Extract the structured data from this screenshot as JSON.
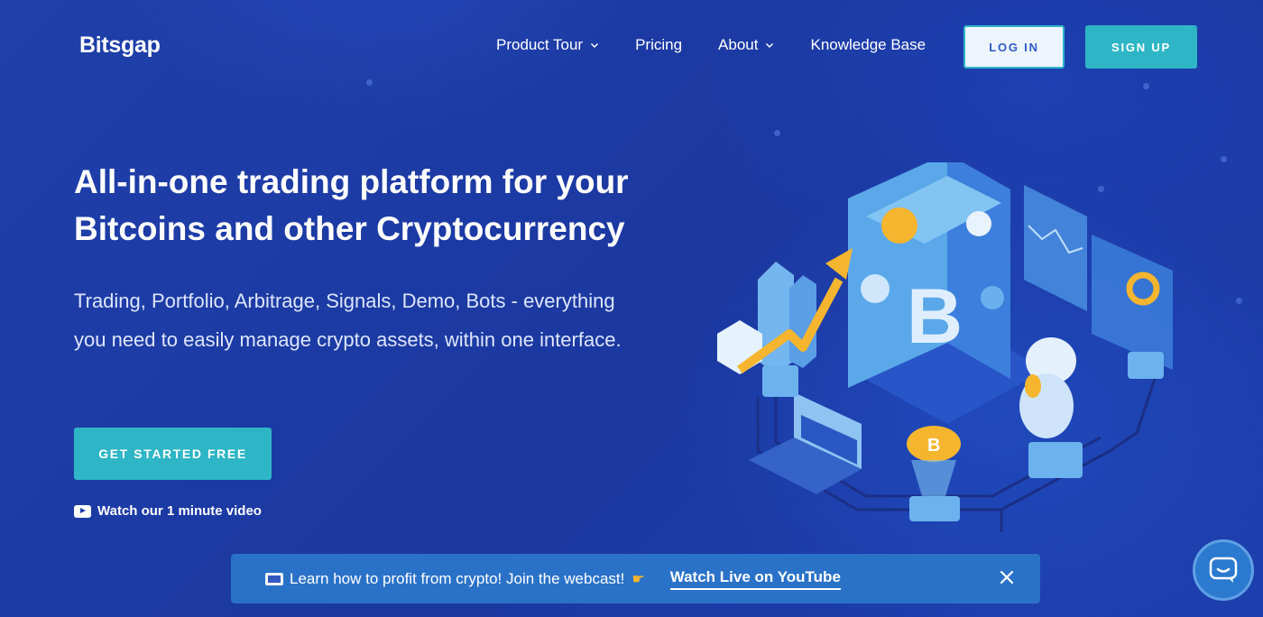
{
  "brand": {
    "logo": "Bitsgap"
  },
  "nav": {
    "items": [
      {
        "label": "Product Tour",
        "dropdown": true
      },
      {
        "label": "Pricing",
        "dropdown": false
      },
      {
        "label": "About",
        "dropdown": true
      },
      {
        "label": "Knowledge Base",
        "dropdown": false
      }
    ],
    "login_label": "LOG IN",
    "signup_label": "SIGN UP"
  },
  "hero": {
    "title_line1": "All-in-one trading platform for your",
    "title_line2": "Bitcoins and other Cryptocurrency",
    "subtitle_line1": "Trading, Portfolio, Arbitrage, Signals, Demo, Bots - everything",
    "subtitle_line2": "you need to easily manage crypto assets, within one interface.",
    "cta_label": "GET STARTED FREE",
    "video_link": "Watch our 1 minute video"
  },
  "banner": {
    "text": "Learn how to profit from crypto! Join the webcast!",
    "link": "Watch Live on YouTube"
  },
  "colors": {
    "background": "#1e3ea6",
    "accent": "#2eb6c6",
    "banner": "#2a72c8",
    "coin": "#f5b52e"
  },
  "icons": [
    "chevron-down-icon",
    "youtube-icon",
    "pointing-hand-icon",
    "close-icon",
    "chat-icon"
  ]
}
